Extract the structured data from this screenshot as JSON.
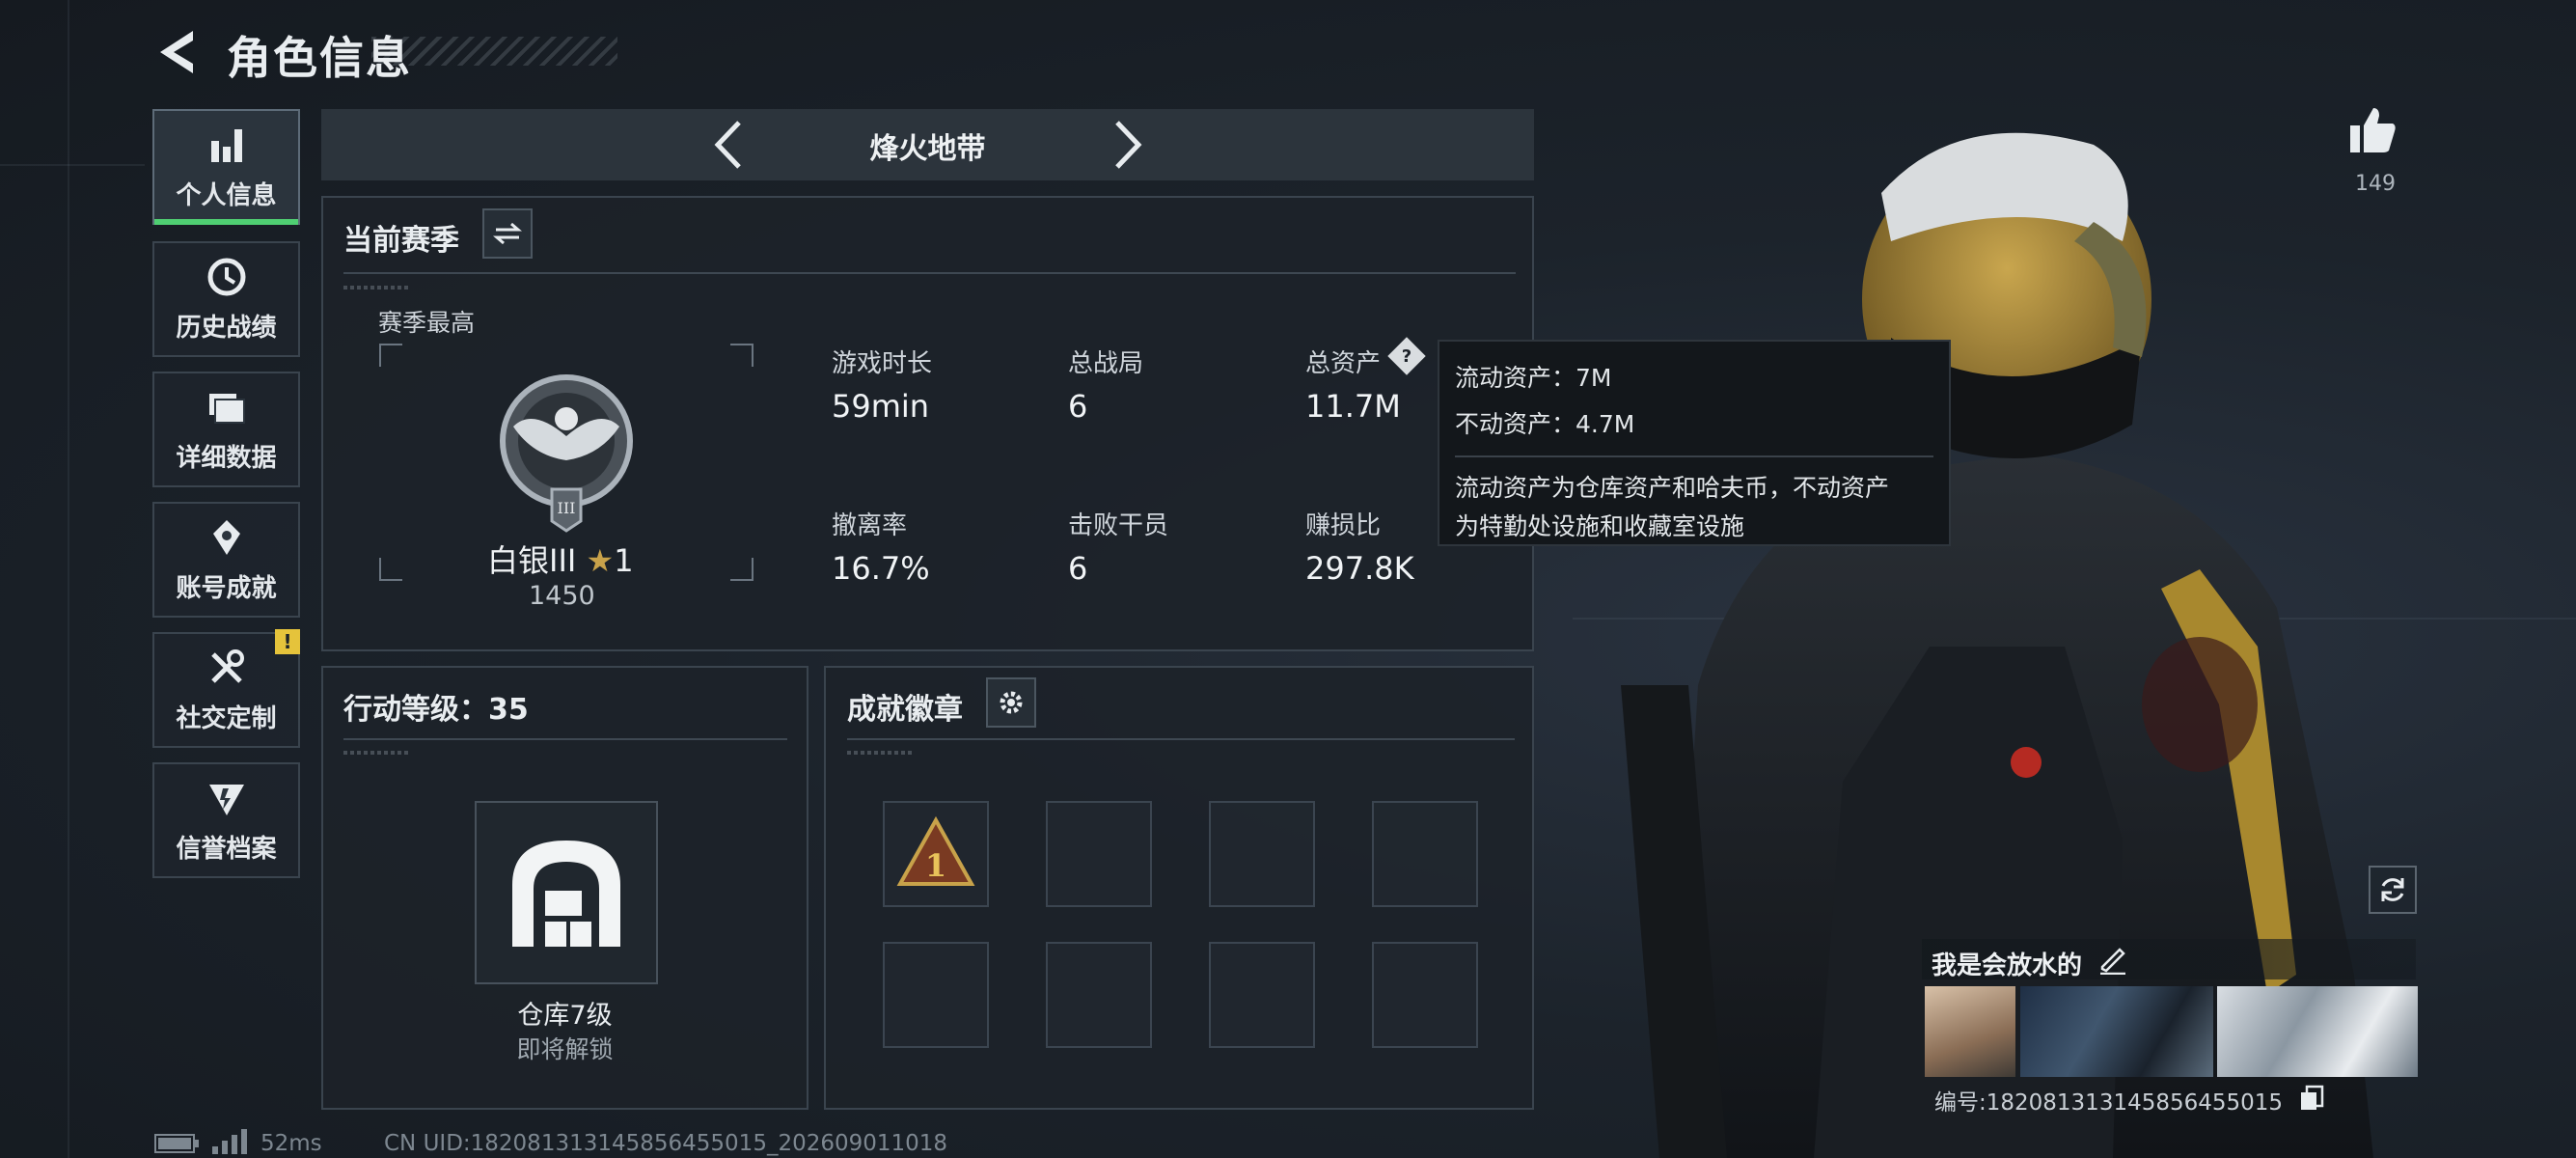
{
  "header": {
    "title": "角色信息"
  },
  "sidebar": {
    "items": [
      {
        "label": "个人信息",
        "icon": "bar-chart-icon"
      },
      {
        "label": "历史战绩",
        "icon": "clock-icon"
      },
      {
        "label": "详细数据",
        "icon": "folder-icon"
      },
      {
        "label": "账号成就",
        "icon": "achievement-icon"
      },
      {
        "label": "社交定制",
        "icon": "tools-icon"
      },
      {
        "label": "信誉档案",
        "icon": "shield-icon"
      }
    ],
    "warning_badge": "!"
  },
  "mode": {
    "title": "烽火地带"
  },
  "season": {
    "title": "当前赛季",
    "best_label": "赛季最高",
    "rank_name": "白银III",
    "rank_stars": "1",
    "rank_points": "1450",
    "stats": [
      {
        "label": "游戏时长",
        "value": "59min"
      },
      {
        "label": "总战局",
        "value": "6"
      },
      {
        "label": "总资产",
        "value": "11.7M"
      },
      {
        "label": "撤离率",
        "value": "16.7%"
      },
      {
        "label": "击败干员",
        "value": "6"
      },
      {
        "label": "赚损比",
        "value": "297.8K"
      }
    ]
  },
  "tooltip": {
    "liquid": "流动资产：7M",
    "fixed": "不动资产：4.7M",
    "desc_line1": "流动资产为仓库资产和哈夫币，不动资产",
    "desc_line2": "为特勤处设施和收藏室设施"
  },
  "action_level": {
    "title": "行动等级：35",
    "item_name": "仓库7级",
    "item_status": "即将解锁"
  },
  "badges": {
    "title": "成就徽章"
  },
  "profile": {
    "likes": "149",
    "player_name": "我是会放水的",
    "player_id": "编号:1820813131458564550​15"
  },
  "footer": {
    "ping": "52ms",
    "uid": "CN UID:1820813131458564550​15_202609011018"
  },
  "colors": {
    "accent": "#4fcf72",
    "warning": "#e5c33b",
    "gold": "#c8a24a"
  }
}
